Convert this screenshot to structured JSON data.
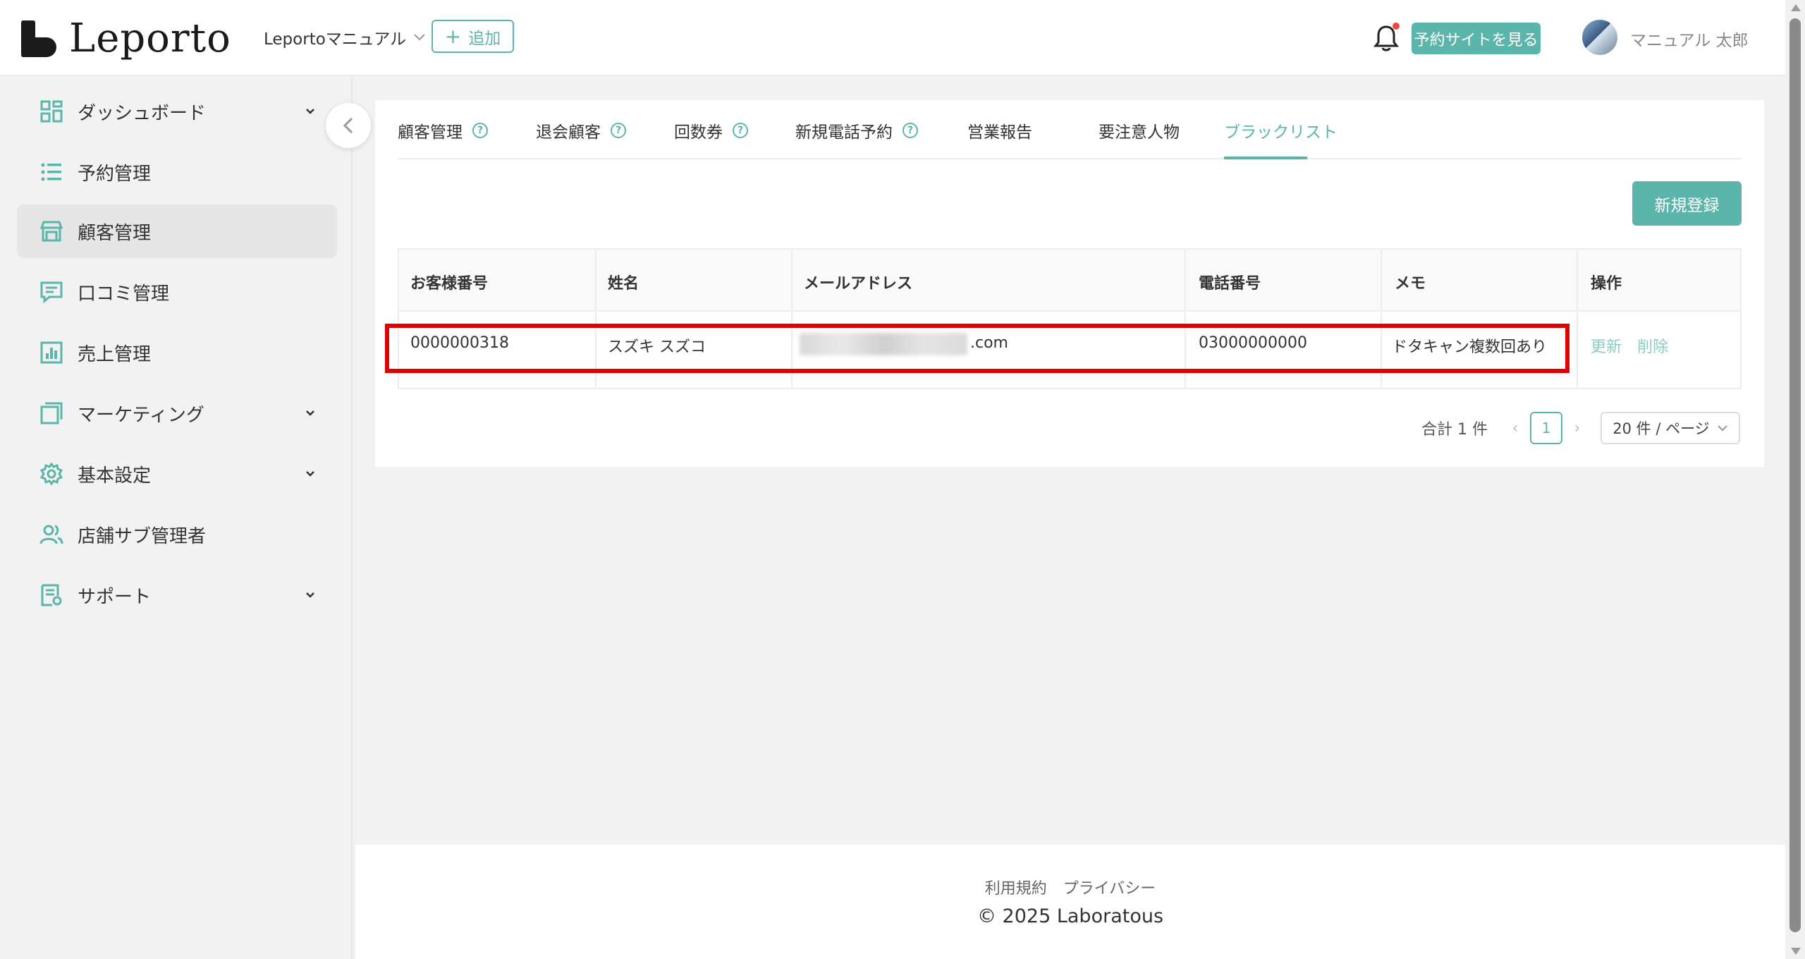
{
  "header": {
    "logo_text": "Leporto",
    "shop_name": "Leportoマニュアル",
    "add_label": "追加",
    "site_button": "予約サイトを見る",
    "user_name": "マニュアル 太郎"
  },
  "sidebar": {
    "items": [
      {
        "label": "ダッシュボード",
        "icon": "dashboard-icon",
        "has_arrow": true
      },
      {
        "label": "予約管理",
        "icon": "list-icon",
        "has_arrow": false
      },
      {
        "label": "顧客管理",
        "icon": "store-icon",
        "has_arrow": false,
        "active": true
      },
      {
        "label": "口コミ管理",
        "icon": "comment-icon",
        "has_arrow": false
      },
      {
        "label": "売上管理",
        "icon": "chart-icon",
        "has_arrow": false
      },
      {
        "label": "マーケティング",
        "icon": "window-icon",
        "has_arrow": true
      },
      {
        "label": "基本設定",
        "icon": "gear-icon",
        "has_arrow": true
      },
      {
        "label": "店舗サブ管理者",
        "icon": "users-icon",
        "has_arrow": false
      },
      {
        "label": "サポート",
        "icon": "document-icon",
        "has_arrow": true
      }
    ]
  },
  "tabs": [
    {
      "label": "顧客管理",
      "help": true
    },
    {
      "label": "退会顧客",
      "help": true
    },
    {
      "label": "回数券",
      "help": true
    },
    {
      "label": "新規電話予約",
      "help": true
    },
    {
      "label": "営業報告",
      "help": false
    },
    {
      "label": "要注意人物",
      "help": false
    },
    {
      "label": "ブラックリスト",
      "help": false,
      "active": true
    }
  ],
  "new_button": "新規登録",
  "table": {
    "headers": [
      "お客様番号",
      "姓名",
      "メールアドレス",
      "電話番号",
      "メモ",
      "操作"
    ],
    "rows": [
      {
        "customer_no": "0000000318",
        "name": "スズキ スズコ",
        "email_suffix": ".com",
        "phone": "03000000000",
        "memo": "ドタキャン複数回あり",
        "actions": [
          "更新",
          "削除"
        ]
      }
    ]
  },
  "pagination": {
    "total": "合計 1 件",
    "current_page": "1",
    "per_page": "20 件 / ページ"
  },
  "footer": {
    "terms": "利用規約",
    "privacy": "プライバシー",
    "copyright": "© 2025 Laboratous"
  },
  "colors": {
    "accent": "#5bb5ab",
    "highlight": "#e00000"
  }
}
